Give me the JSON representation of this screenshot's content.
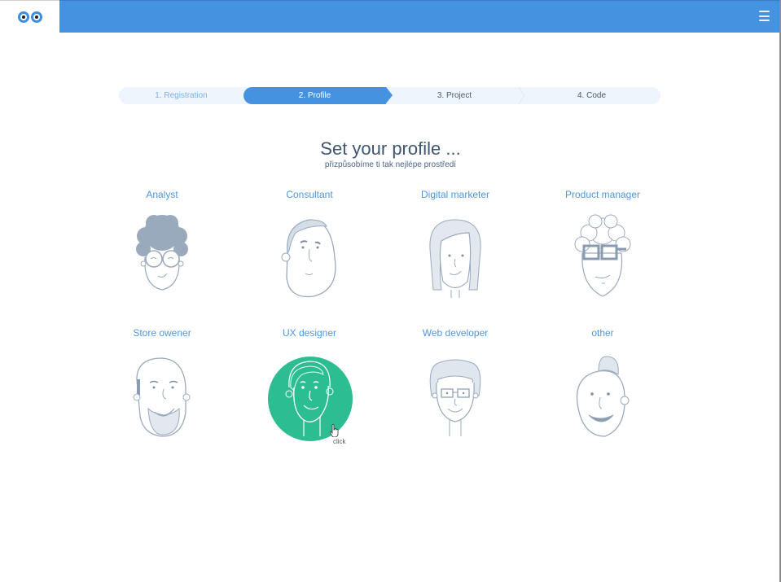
{
  "header": {
    "logo_icon": "eyes-logo-icon",
    "menu_icon": "hamburger-menu-icon",
    "accent_color": "#4593e0"
  },
  "stepper": {
    "steps": [
      {
        "label": "1. Registration",
        "state": "completed"
      },
      {
        "label": "2. Profile",
        "state": "active"
      },
      {
        "label": "3. Project",
        "state": "upcoming"
      },
      {
        "label": "4. Code",
        "state": "upcoming"
      }
    ]
  },
  "main": {
    "title": "Set your profile ...",
    "subtitle": "přizpůsobíme ti tak nejlépe prostředí",
    "profiles": [
      {
        "label": "Analyst",
        "icon": "analyst-avatar-icon"
      },
      {
        "label": "Consultant",
        "icon": "consultant-avatar-icon"
      },
      {
        "label": "Digital marketer",
        "icon": "digital-marketer-avatar-icon"
      },
      {
        "label": "Product manager",
        "icon": "product-manager-avatar-icon"
      },
      {
        "label": "Store owener",
        "icon": "store-owner-avatar-icon"
      },
      {
        "label": "UX designer",
        "icon": "ux-designer-avatar-icon",
        "selected": true,
        "highlight_color": "#2dbd93"
      },
      {
        "label": "Web developer",
        "icon": "web-developer-avatar-icon"
      },
      {
        "label": "other",
        "icon": "other-avatar-icon"
      }
    ]
  },
  "cursor": {
    "icon": "hand-pointer-icon",
    "label": "click"
  }
}
